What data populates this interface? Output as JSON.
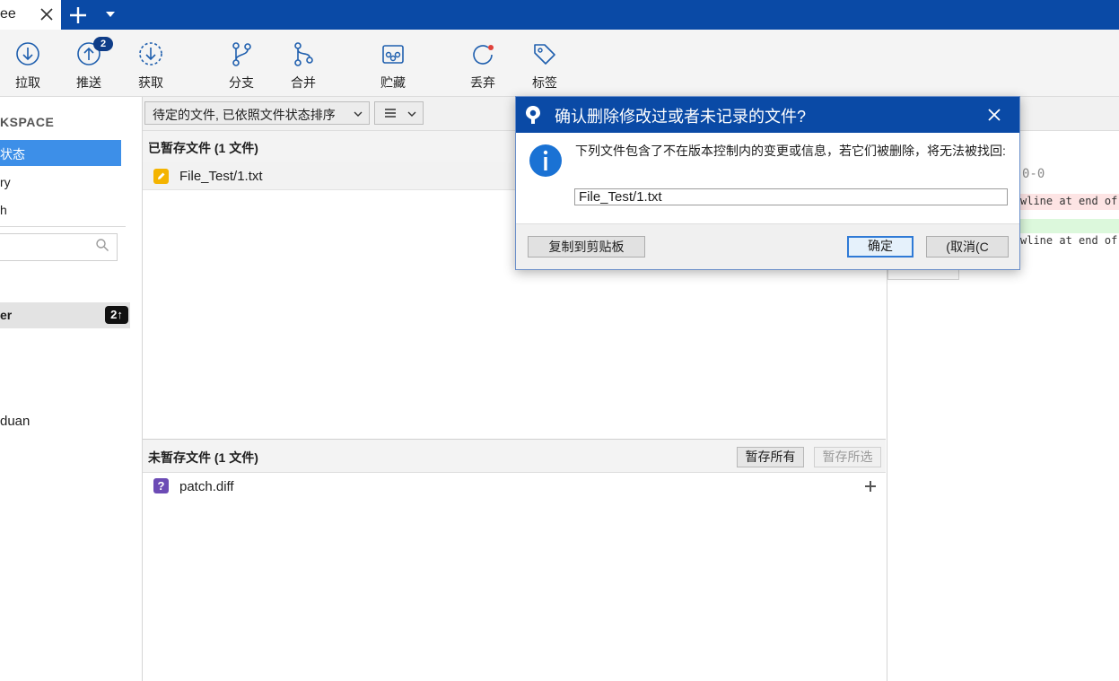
{
  "tab": {
    "title": "ee"
  },
  "toolbar": {
    "items": [
      {
        "label": "拉取"
      },
      {
        "label": "推送",
        "badge": "2"
      },
      {
        "label": "获取"
      },
      {
        "label": "分支"
      },
      {
        "label": "合并"
      },
      {
        "label": "贮藏"
      },
      {
        "label": "丢弃"
      },
      {
        "label": "标签"
      }
    ]
  },
  "sidebar": {
    "workspace_title": "KSPACE",
    "items": [
      {
        "label": "状态",
        "selected": true
      },
      {
        "label": "ry"
      },
      {
        "label": "h"
      }
    ],
    "branch": {
      "label": "er",
      "badge": "2↑"
    },
    "remote_label": "duan"
  },
  "filter": {
    "sort_label": "待定的文件, 已依照文件状态排序"
  },
  "staged": {
    "title": "已暂存文件  (1 文件)",
    "files": [
      {
        "name": "File_Test/1.txt",
        "status_icon": "modified-icon"
      }
    ]
  },
  "unstaged": {
    "title": "未暂存文件  (1 文件)",
    "stage_all_label": "暂存所有",
    "stage_selected_label": "暂存所选",
    "files": [
      {
        "name": "patch.diff",
        "status_icon": "untracked-icon"
      }
    ]
  },
  "diff": {
    "hunk_fragment": "0-0",
    "line1_fragment": "wline at end of",
    "line3_fragment": "wline at end of"
  },
  "dialog": {
    "title": "确认删除修改过或者未记录的文件?",
    "message": "下列文件包含了不在版本控制内的变更或信息，若它们被删除，将无法被找回:",
    "file_value": "File_Test/1.txt",
    "copy_label": "复制到剪贴板",
    "ok_label": "确定",
    "cancel_label": "(取消(C"
  },
  "colors": {
    "titlebar": "#0a4aa6",
    "selection": "#3d8fe8",
    "badge": "#0f3d88"
  }
}
